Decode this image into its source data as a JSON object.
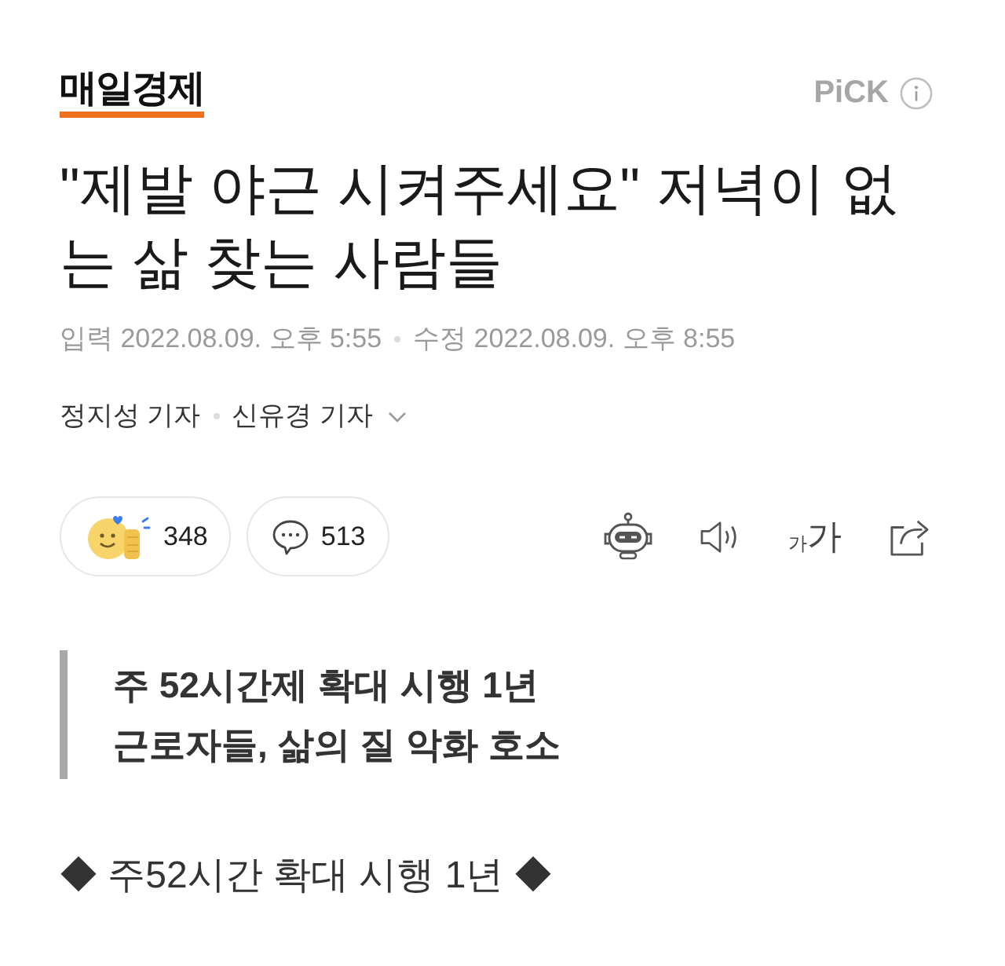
{
  "header": {
    "logo": "매일경제",
    "badge": "PiCK"
  },
  "headline": "\"제발 야근 시켜주세요\" 저녁이 없는 삶 찾는 사람들",
  "dates": [
    "입력 2022.08.09. 오후 5:55",
    "수정 2022.08.09. 오후 8:55"
  ],
  "reporters": [
    "정지성 기자",
    "신유경 기자"
  ],
  "reactions": {
    "likes": "348",
    "comments": "513"
  },
  "text_size": {
    "small": "가",
    "large": "가"
  },
  "subheadline": [
    "주 52시간제 확대 시행 1년",
    "근로자들, 삶의 질 악화 호소"
  ],
  "section_title": "◆ 주52시간 확대 시행 1년 ◆"
}
